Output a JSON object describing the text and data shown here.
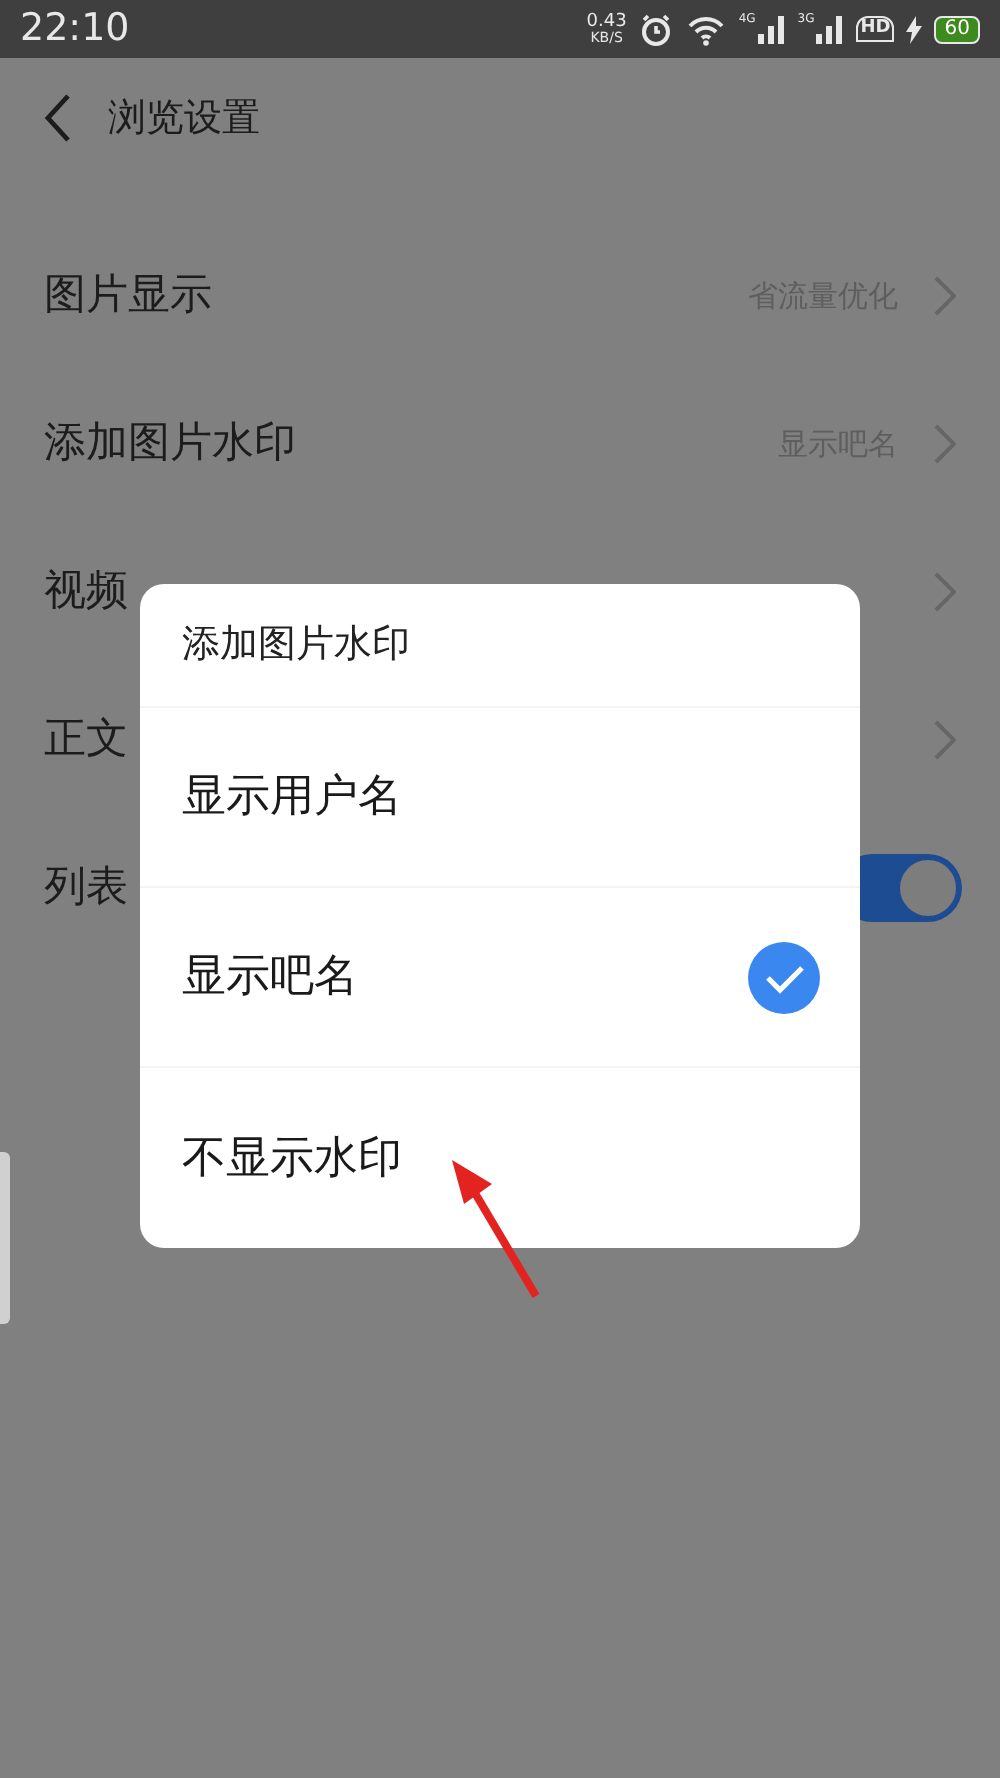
{
  "status_bar": {
    "time": "22:10",
    "speed_value": "0.43",
    "speed_unit": "KB/S",
    "network_1": "4G",
    "network_2": "3G",
    "hd": "HD",
    "battery": "60"
  },
  "header": {
    "title": "浏览设置"
  },
  "settings": [
    {
      "kind": "value",
      "label": "图片显示",
      "value": "省流量优化"
    },
    {
      "kind": "value",
      "label": "添加图片水印",
      "value": "显示吧名"
    },
    {
      "kind": "value",
      "label": "视频"
    },
    {
      "kind": "value",
      "label": "正文"
    },
    {
      "kind": "toggle",
      "label": "列表",
      "on": true
    }
  ],
  "dialog": {
    "title": "添加图片水印",
    "options": [
      {
        "label": "显示用户名",
        "selected": false
      },
      {
        "label": "显示吧名",
        "selected": true
      },
      {
        "label": "不显示水印",
        "selected": false
      }
    ]
  }
}
